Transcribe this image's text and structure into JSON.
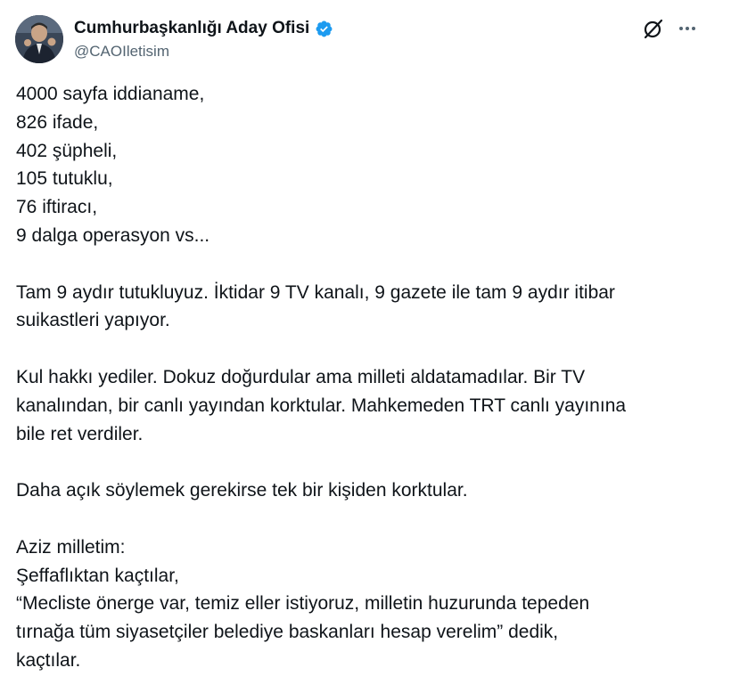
{
  "author": {
    "display_name": "Cumhurbaşkanlığı Aday Ofisi",
    "handle": "@CAOIletisim",
    "verified": true,
    "verified_color": "#1d9bf0"
  },
  "icons": {
    "grok": "grok-icon",
    "more": "more-options-icon",
    "verified": "verified-badge-icon"
  },
  "tweet": {
    "lines": [
      "4000 sayfa iddianame,",
      "826 ifade,",
      "402 şüpheli,",
      "105 tutuklu,",
      "76 iftiracı,",
      "9 dalga operasyon vs...",
      "",
      "Tam 9 aydır tutukluyuz. İktidar 9 TV kanalı, 9 gazete ile tam 9 aydır itibar",
      "suikastleri yapıyor.",
      "",
      "Kul hakkı yediler. Dokuz doğurdular ama milleti aldatamadılar. Bir TV",
      "kanalından, bir canlı yayından korktular. Mahkemeden TRT canlı yayınına",
      "bile ret verdiler.",
      "",
      "Daha açık söylemek gerekirse tek bir kişiden korktular.",
      "",
      "Aziz milletim:",
      "Şeffaflıktan kaçtılar,",
      "“Mecliste önerge var, temiz eller istiyoruz, milletin huzurunda tepeden",
      "tırnağa tüm siyasetçiler belediye baskanları hesap verelim” dedik,",
      "kaçtılar."
    ]
  }
}
